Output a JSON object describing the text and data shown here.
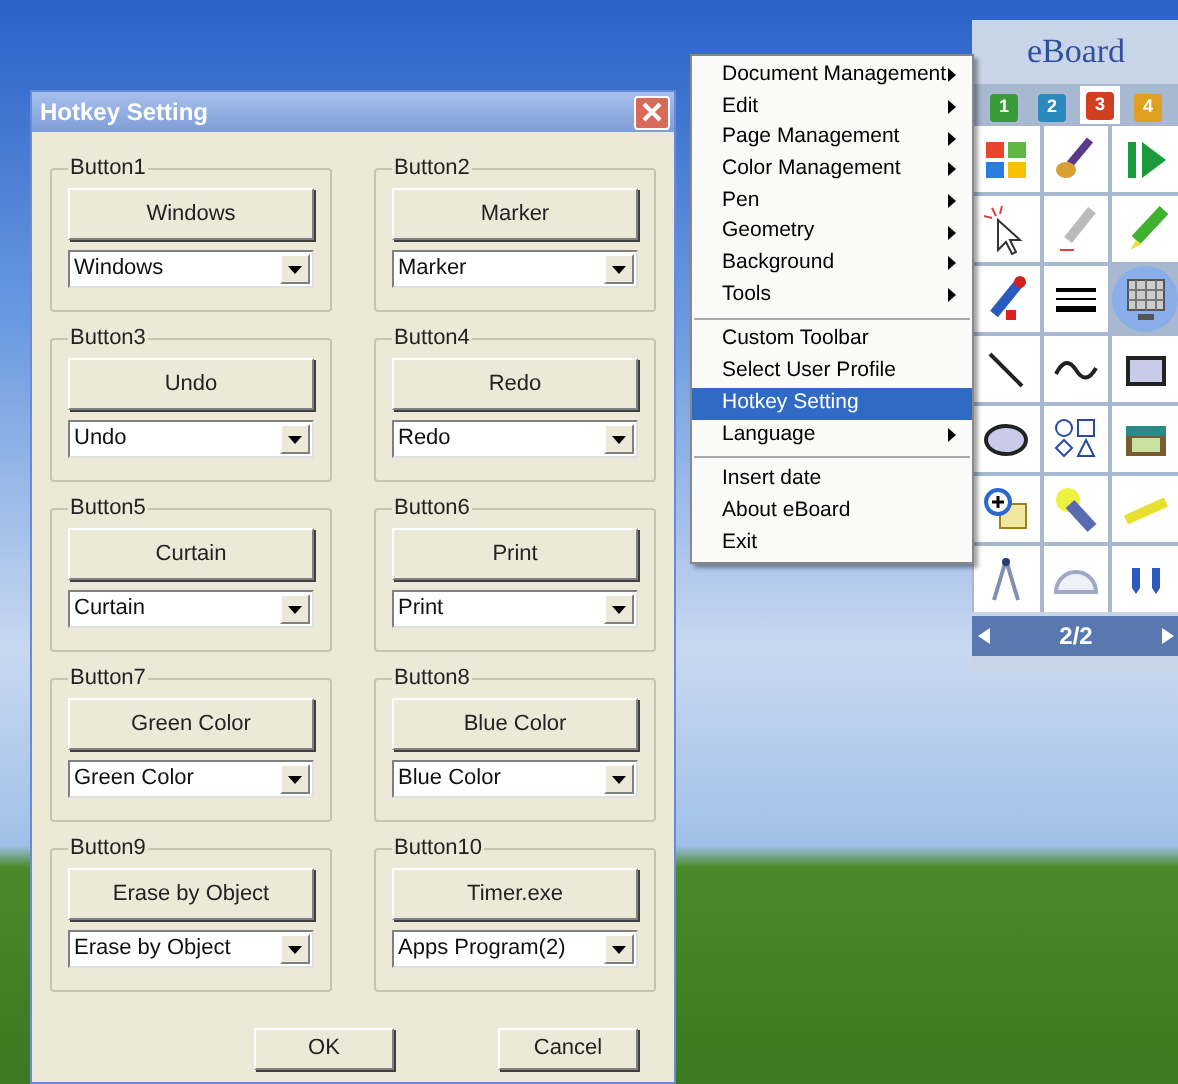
{
  "dialog": {
    "title": "Hotkey Setting",
    "groups": [
      {
        "label": "Button1",
        "button": "Windows",
        "select": "Windows"
      },
      {
        "label": "Button2",
        "button": "Marker",
        "select": "Marker"
      },
      {
        "label": "Button3",
        "button": "Undo",
        "select": "Undo"
      },
      {
        "label": "Button4",
        "button": "Redo",
        "select": "Redo"
      },
      {
        "label": "Button5",
        "button": "Curtain",
        "select": "Curtain"
      },
      {
        "label": "Button6",
        "button": "Print",
        "select": "Print"
      },
      {
        "label": "Button7",
        "button": "Green Color",
        "select": "Green Color"
      },
      {
        "label": "Button8",
        "button": "Blue Color",
        "select": "Blue Color"
      },
      {
        "label": "Button9",
        "button": "Erase by Object",
        "select": "Erase by Object"
      },
      {
        "label": "Button10",
        "button": "Timer.exe",
        "select": "Apps Program(2)"
      }
    ],
    "buttons": [
      "OK",
      "Cancel"
    ]
  },
  "menu": {
    "items": [
      {
        "kind": "item",
        "label": "Document Management",
        "submenu": true,
        "selected": false
      },
      {
        "kind": "item",
        "label": "Edit",
        "submenu": true,
        "selected": false
      },
      {
        "kind": "item",
        "label": "Page Management",
        "submenu": true,
        "selected": false
      },
      {
        "kind": "item",
        "label": "Color Management",
        "submenu": true,
        "selected": false
      },
      {
        "kind": "item",
        "label": "Pen",
        "submenu": true,
        "selected": false
      },
      {
        "kind": "item",
        "label": "Geometry",
        "submenu": true,
        "selected": false
      },
      {
        "kind": "item",
        "label": "Background",
        "submenu": true,
        "selected": false
      },
      {
        "kind": "item",
        "label": "Tools",
        "submenu": true,
        "selected": false
      },
      {
        "kind": "separator"
      },
      {
        "kind": "item",
        "label": "Custom Toolbar",
        "submenu": false,
        "selected": false
      },
      {
        "kind": "item",
        "label": "Select User Profile",
        "submenu": false,
        "selected": false
      },
      {
        "kind": "item",
        "label": "Hotkey Setting",
        "submenu": false,
        "selected": true
      },
      {
        "kind": "item",
        "label": "Language",
        "submenu": true,
        "selected": false
      },
      {
        "kind": "separator"
      },
      {
        "kind": "item",
        "label": "Insert date",
        "submenu": false,
        "selected": false
      },
      {
        "kind": "item",
        "label": "About eBoard",
        "submenu": false,
        "selected": false
      },
      {
        "kind": "item",
        "label": "Exit",
        "submenu": false,
        "selected": false
      }
    ]
  },
  "toolbar": {
    "title": "eBoard",
    "tabs": [
      {
        "label": "1",
        "color": "#3a9a3a",
        "selected": false
      },
      {
        "label": "2",
        "color": "#2a8ac0",
        "selected": false
      },
      {
        "label": "3",
        "color": "#d04020",
        "selected": true
      },
      {
        "label": "4",
        "color": "#e0a020",
        "selected": false
      }
    ],
    "tools": [
      {
        "kind": "windows",
        "selected": false
      },
      {
        "kind": "brush",
        "selected": false
      },
      {
        "kind": "play",
        "selected": false
      },
      {
        "kind": "pointer",
        "selected": false
      },
      {
        "kind": "highlighter",
        "selected": false
      },
      {
        "kind": "pencil",
        "selected": false
      },
      {
        "kind": "marker",
        "selected": false
      },
      {
        "kind": "lines",
        "selected": false
      },
      {
        "kind": "screen",
        "selected": true
      },
      {
        "kind": "line",
        "selected": false
      },
      {
        "kind": "wave",
        "selected": false
      },
      {
        "kind": "rectangle",
        "selected": false
      },
      {
        "kind": "ellipse",
        "selected": false
      },
      {
        "kind": "shapes",
        "selected": false
      },
      {
        "kind": "chest",
        "selected": false
      },
      {
        "kind": "zoom",
        "selected": false
      },
      {
        "kind": "flashlight",
        "selected": false
      },
      {
        "kind": "ruler",
        "selected": false
      },
      {
        "kind": "compass",
        "selected": false
      },
      {
        "kind": "protractor",
        "selected": false
      },
      {
        "kind": "magnet",
        "selected": false
      }
    ],
    "pager": "2/2"
  }
}
